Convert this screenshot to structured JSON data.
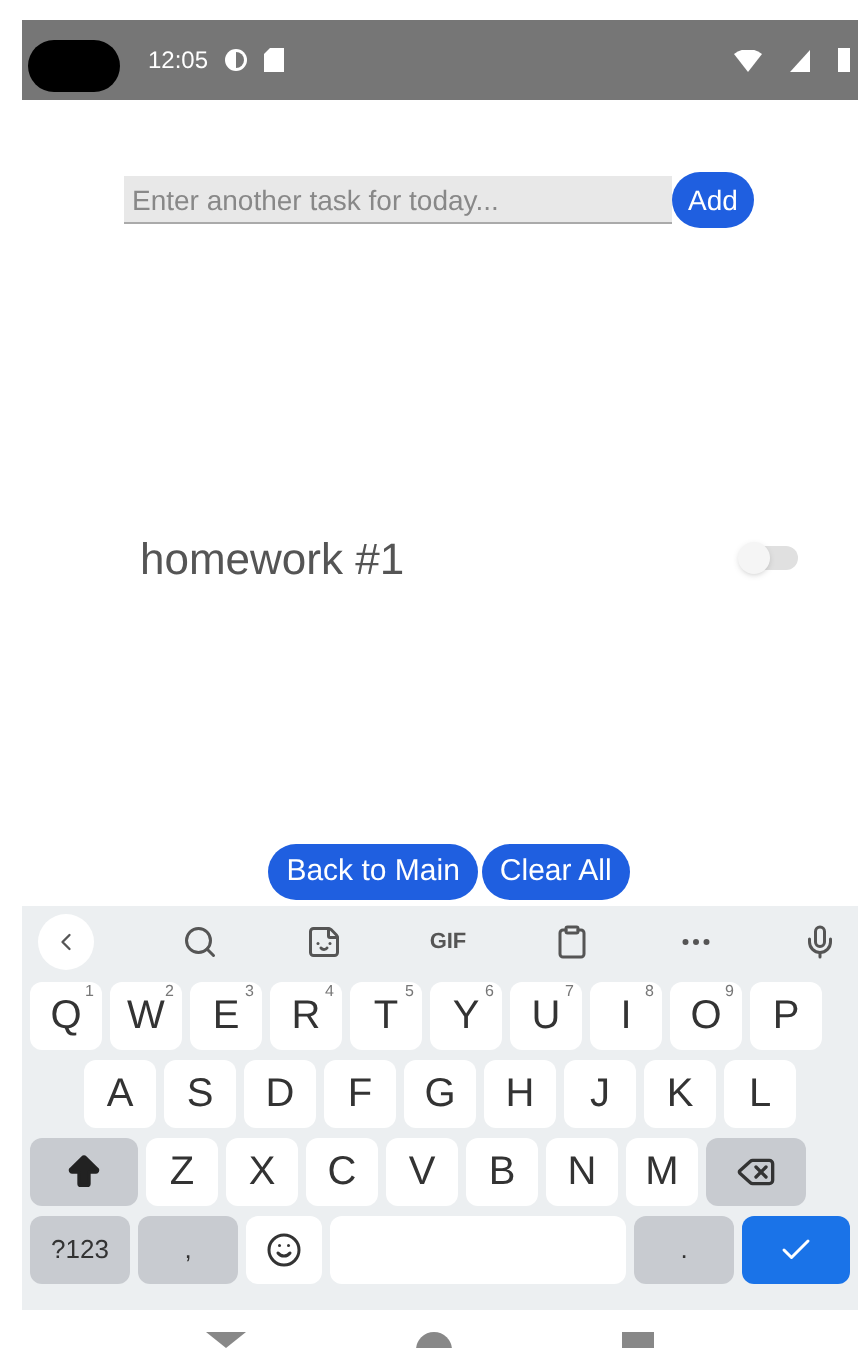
{
  "status_bar": {
    "time": "12:05"
  },
  "task_input": {
    "placeholder": "Enter another task for today..."
  },
  "add_button": "Add",
  "tasks": [
    {
      "title": "homework #1",
      "on": false
    }
  ],
  "buttons": [
    "Back to Main",
    "Clear All"
  ],
  "keyboard": {
    "toolbar": [
      {
        "kind": "back"
      },
      {
        "kind": "search"
      },
      {
        "kind": "sticker"
      },
      {
        "kind": "gif",
        "label": "GIF"
      },
      {
        "kind": "clipboard"
      },
      {
        "kind": "more"
      },
      {
        "kind": "mic"
      }
    ],
    "rows": [
      [
        {
          "kind": "letter",
          "label": "Q",
          "hint": "1"
        },
        {
          "kind": "letter",
          "label": "W",
          "hint": "2"
        },
        {
          "kind": "letter",
          "label": "E",
          "hint": "3"
        },
        {
          "kind": "letter",
          "label": "R",
          "hint": "4"
        },
        {
          "kind": "letter",
          "label": "T",
          "hint": "5"
        },
        {
          "kind": "letter",
          "label": "Y",
          "hint": "6"
        },
        {
          "kind": "letter",
          "label": "U",
          "hint": "7"
        },
        {
          "kind": "letter",
          "label": "I",
          "hint": "8"
        },
        {
          "kind": "letter",
          "label": "O",
          "hint": "9"
        },
        {
          "kind": "letter",
          "label": "P"
        }
      ],
      [
        {
          "kind": "letter",
          "label": "A"
        },
        {
          "kind": "letter",
          "label": "S"
        },
        {
          "kind": "letter",
          "label": "D"
        },
        {
          "kind": "letter",
          "label": "F"
        },
        {
          "kind": "letter",
          "label": "G"
        },
        {
          "kind": "letter",
          "label": "H"
        },
        {
          "kind": "letter",
          "label": "J"
        },
        {
          "kind": "letter",
          "label": "K"
        },
        {
          "kind": "letter",
          "label": "L"
        }
      ],
      [
        {
          "kind": "shift"
        },
        {
          "kind": "letter",
          "label": "Z"
        },
        {
          "kind": "letter",
          "label": "X"
        },
        {
          "kind": "letter",
          "label": "C"
        },
        {
          "kind": "letter",
          "label": "V"
        },
        {
          "kind": "letter",
          "label": "B"
        },
        {
          "kind": "letter",
          "label": "N"
        },
        {
          "kind": "letter",
          "label": "M"
        },
        {
          "kind": "backspace"
        }
      ],
      [
        {
          "kind": "symbol",
          "label": "?123"
        },
        {
          "kind": "symbol",
          "label": ","
        },
        {
          "kind": "emoji"
        },
        {
          "kind": "space"
        },
        {
          "kind": "symbol",
          "label": "."
        },
        {
          "kind": "enter"
        }
      ]
    ]
  }
}
